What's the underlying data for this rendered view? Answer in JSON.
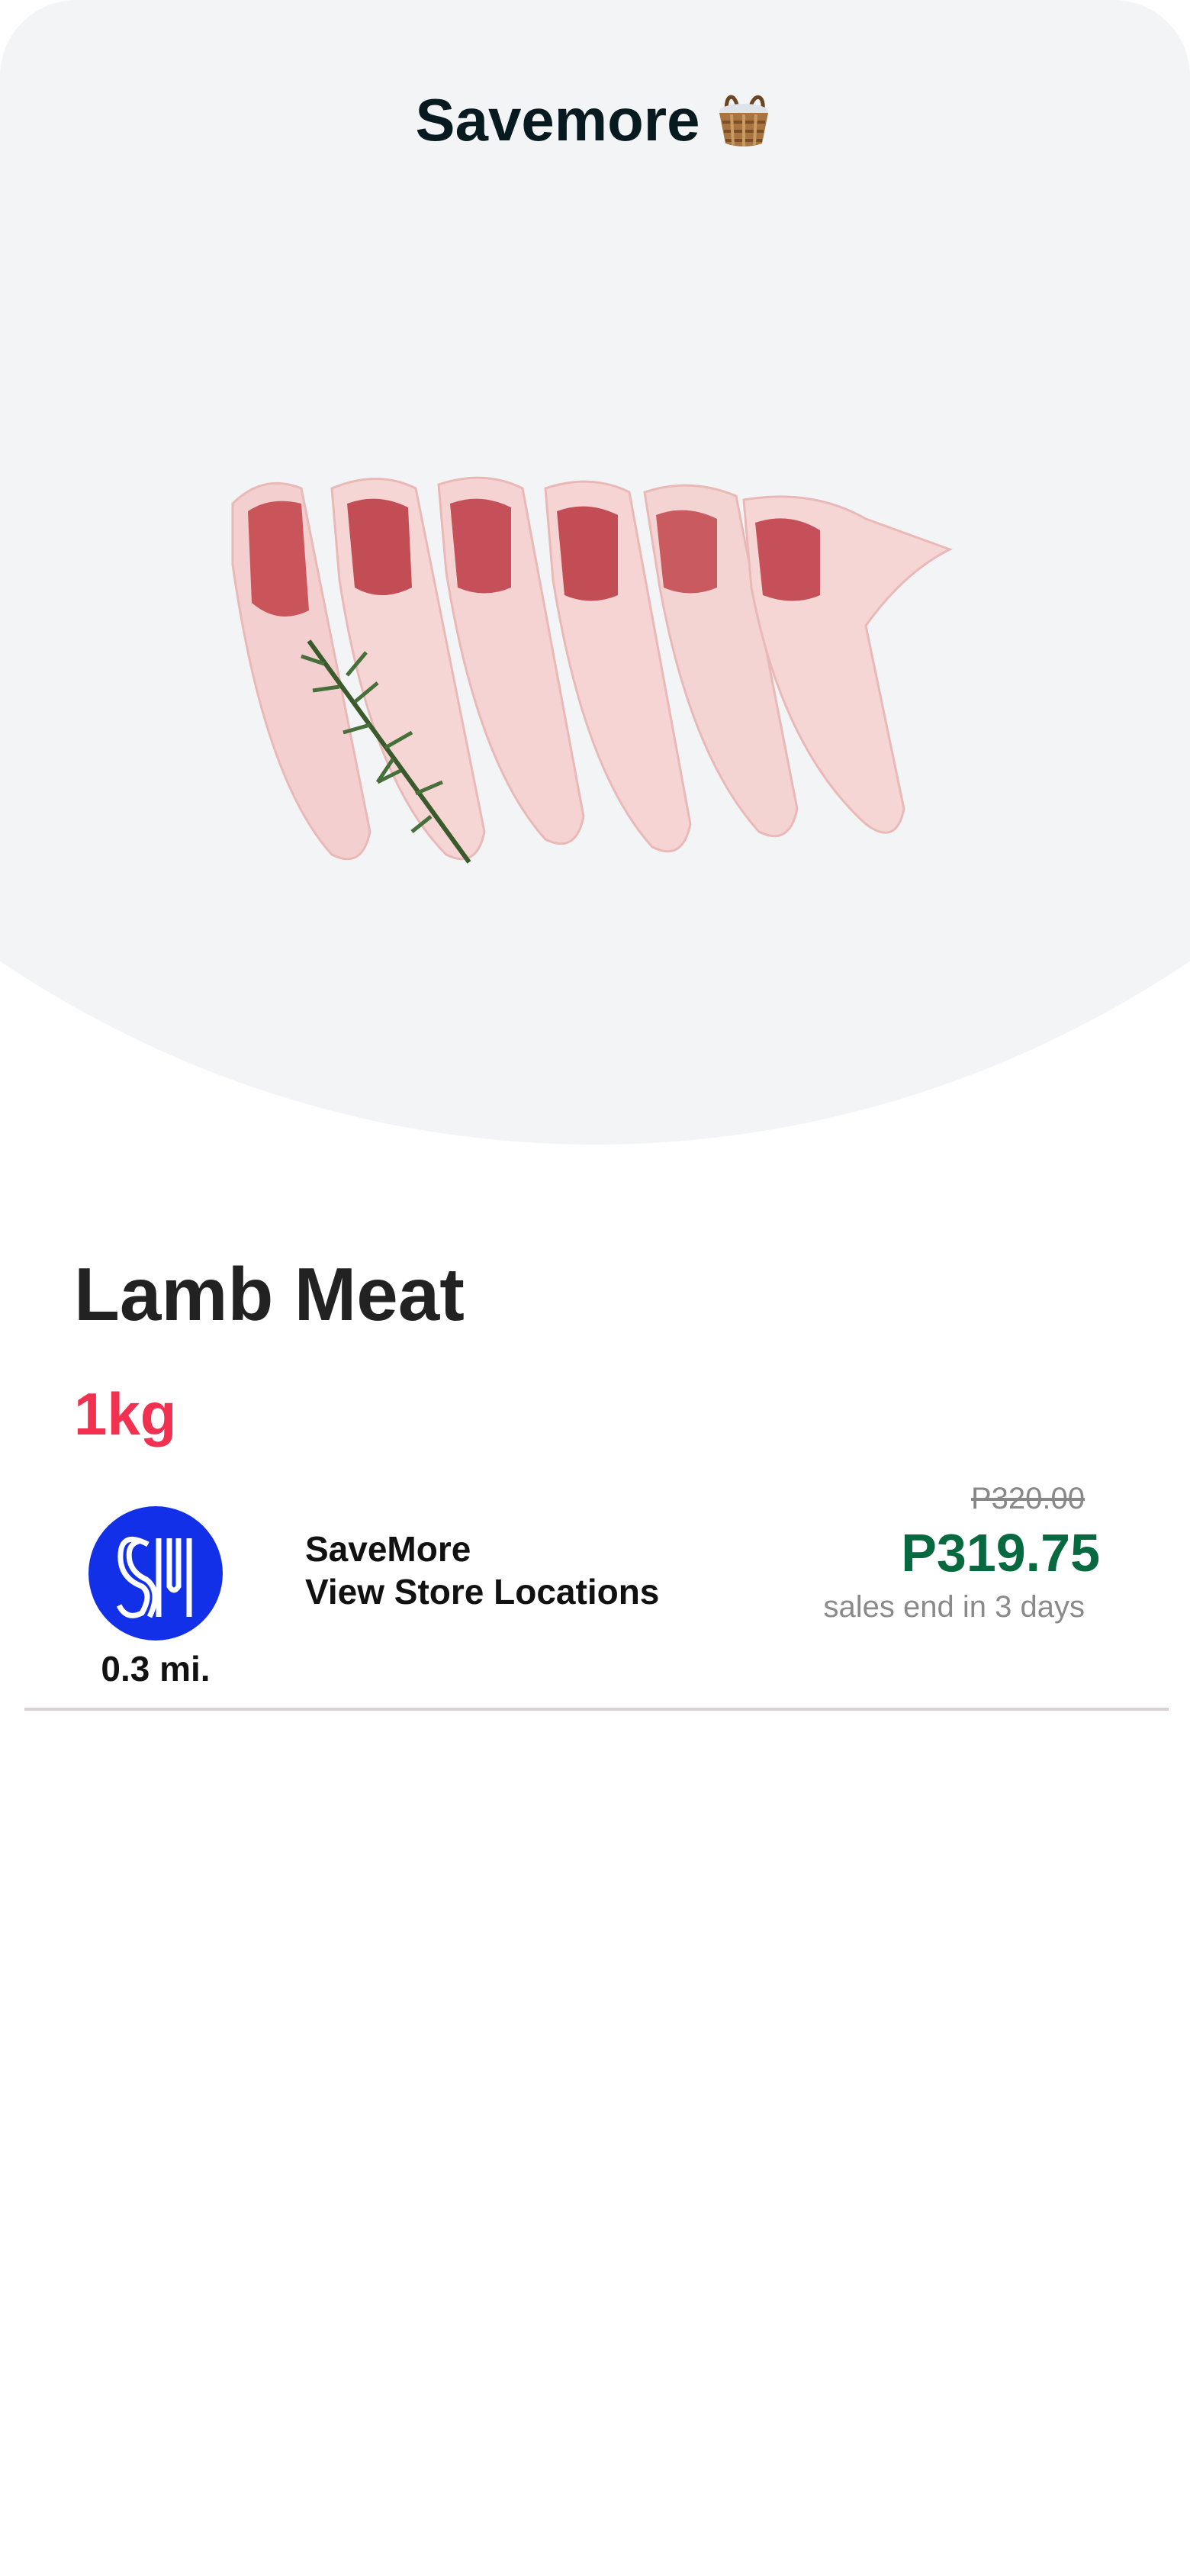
{
  "header": {
    "title": "Savemore",
    "title_icon": "basket-icon"
  },
  "product": {
    "name": "Lamb Meat",
    "quantity": "1kg",
    "image": "lamb-rack-image"
  },
  "store": {
    "logo_icon": "sm-logo",
    "distance": "0.3 mi.",
    "name": "SaveMore",
    "locations_link": "View Store Locations"
  },
  "pricing": {
    "original_price": "P320.00",
    "sale_price": "P319.75",
    "sale_note": "sales end in 3 days"
  },
  "colors": {
    "header_bg": "#f3f4f6",
    "quantity": "#f2304f",
    "sale_price": "#07693f",
    "logo_blue": "#1230e8"
  }
}
